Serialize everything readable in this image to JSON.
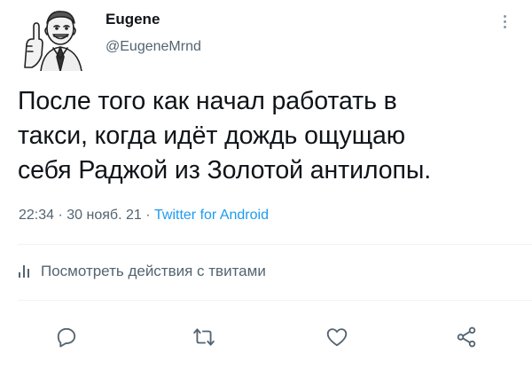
{
  "user": {
    "name": "Eugene",
    "handle": "@EugeneMrnd"
  },
  "tweet": {
    "lines": [
      "После того как начал работать в",
      "такси, когда идёт дождь ощущаю",
      "себя Раджой из Золотой антилопы."
    ],
    "time": "22:34",
    "date": "30 нояб. 21",
    "separator": "·",
    "source": "Twitter for Android"
  },
  "activity": {
    "label": "Посмотреть действия с твитами"
  },
  "icons": {
    "more": "more-vertical-icon",
    "activity": "bar-chart-icon",
    "reply": "comment-icon",
    "retweet": "retweet-icon",
    "like": "heart-icon",
    "share": "share-icon"
  },
  "colors": {
    "text": "#0f1419",
    "secondary": "#536471",
    "link": "#1d9bf0",
    "divider": "#eff3f4"
  }
}
